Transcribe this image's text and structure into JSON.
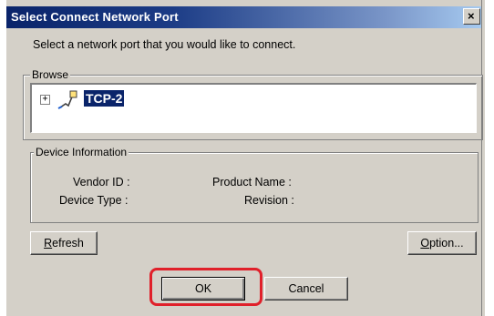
{
  "window": {
    "title": "Select Connect Network Port",
    "close_glyph": "×",
    "close_icon": "close-icon"
  },
  "instruction": "Select a network port that you would like to connect.",
  "browse": {
    "label": "Browse",
    "tree": [
      {
        "label": "TCP-2",
        "expander": "+",
        "icon": "network-port-icon",
        "selected": true
      }
    ]
  },
  "device_info": {
    "label": "Device Information",
    "vendor_id_label": "Vendor ID :",
    "device_type_label": "Device Type :",
    "product_name_label": "Product Name :",
    "revision_label": "Revision :"
  },
  "buttons": {
    "refresh": {
      "mnemonic": "R",
      "rest": "efresh"
    },
    "option": {
      "mnemonic": "O",
      "rest": "ption..."
    },
    "ok": "OK",
    "cancel": "Cancel"
  },
  "annotation": {
    "color": "#e0202a",
    "target": "ok-button"
  },
  "colors": {
    "titlebar": "#0a246a",
    "selection": "#0a246a",
    "face": "#d4d0c8"
  }
}
